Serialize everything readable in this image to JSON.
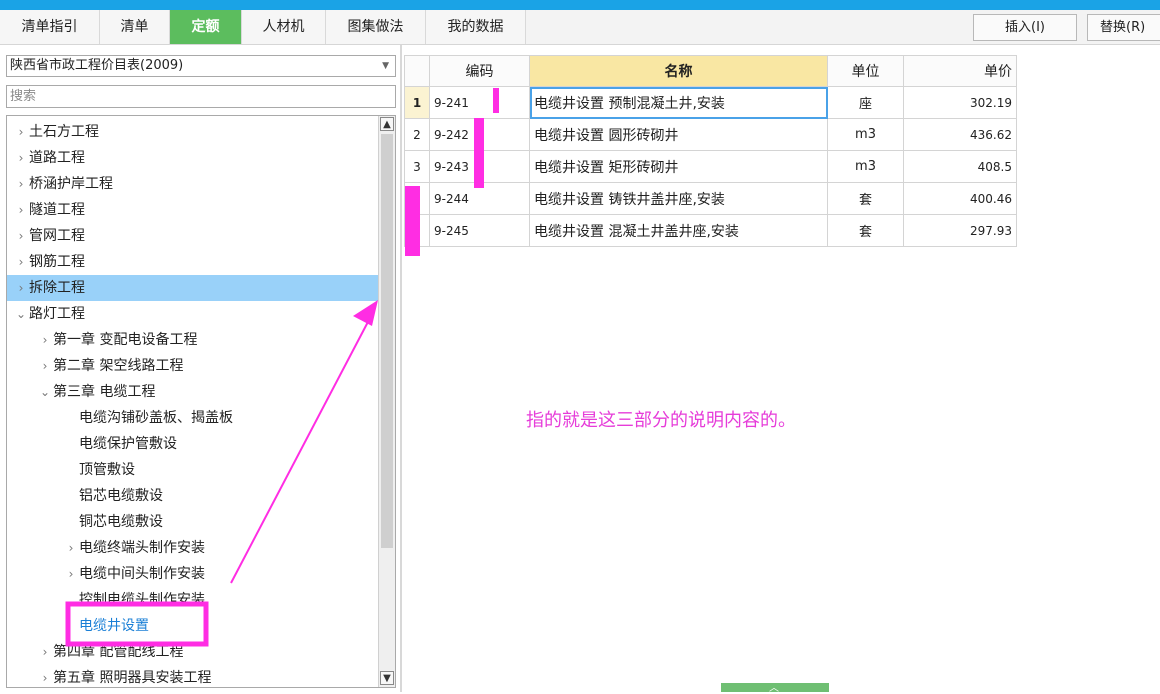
{
  "tabs": [
    {
      "label": "清单指引",
      "active": false
    },
    {
      "label": "清单",
      "active": false
    },
    {
      "label": "定额",
      "active": true
    },
    {
      "label": "人材机",
      "active": false
    },
    {
      "label": "图集做法",
      "active": false
    },
    {
      "label": "我的数据",
      "active": false
    }
  ],
  "toolbar": {
    "insert_label": "插入(I)",
    "replace_label": "替换(R)"
  },
  "left": {
    "library": "陕西省市政工程价目表(2009)",
    "search_placeholder": "搜索",
    "tree": [
      {
        "label": "土石方工程",
        "chevron": "›",
        "level": 0,
        "state": "collapsed"
      },
      {
        "label": "道路工程",
        "chevron": "›",
        "level": 0,
        "state": "collapsed"
      },
      {
        "label": "桥涵护岸工程",
        "chevron": "›",
        "level": 0,
        "state": "collapsed"
      },
      {
        "label": "隧道工程",
        "chevron": "›",
        "level": 0,
        "state": "collapsed"
      },
      {
        "label": "管网工程",
        "chevron": "›",
        "level": 0,
        "state": "collapsed"
      },
      {
        "label": "钢筋工程",
        "chevron": "›",
        "level": 0,
        "state": "collapsed"
      },
      {
        "label": "拆除工程",
        "chevron": "›",
        "level": 0,
        "state": "highlight"
      },
      {
        "label": "路灯工程",
        "chevron": "⌄",
        "level": 0,
        "state": "expanded"
      },
      {
        "label": "第一章 变配电设备工程",
        "chevron": "›",
        "level": 1,
        "state": "collapsed"
      },
      {
        "label": "第二章 架空线路工程",
        "chevron": "›",
        "level": 1,
        "state": "collapsed"
      },
      {
        "label": "第三章 电缆工程",
        "chevron": "⌄",
        "level": 1,
        "state": "expanded"
      },
      {
        "label": "电缆沟铺砂盖板、揭盖板",
        "chevron": "",
        "level": 2,
        "state": "leaf"
      },
      {
        "label": "电缆保护管敷设",
        "chevron": "",
        "level": 2,
        "state": "leaf"
      },
      {
        "label": "顶管敷设",
        "chevron": "",
        "level": 2,
        "state": "leaf"
      },
      {
        "label": "铝芯电缆敷设",
        "chevron": "",
        "level": 2,
        "state": "leaf"
      },
      {
        "label": "铜芯电缆敷设",
        "chevron": "",
        "level": 2,
        "state": "leaf"
      },
      {
        "label": "电缆终端头制作安装",
        "chevron": "›",
        "level": 2,
        "state": "collapsed"
      },
      {
        "label": "电缆中间头制作安装",
        "chevron": "›",
        "level": 2,
        "state": "collapsed"
      },
      {
        "label": "控制电缆头制作安装",
        "chevron": "",
        "level": 2,
        "state": "leaf"
      },
      {
        "label": "电缆井设置",
        "chevron": "",
        "level": 2,
        "state": "selected"
      },
      {
        "label": "第四章 配管配线工程",
        "chevron": "›",
        "level": 1,
        "state": "collapsed"
      },
      {
        "label": "第五章 照明器具安装工程",
        "chevron": "›",
        "level": 1,
        "state": "collapsed"
      }
    ]
  },
  "table": {
    "headers": {
      "code": "编码",
      "name": "名称",
      "unit": "单位",
      "price": "单价"
    },
    "rows": [
      {
        "idx": "1",
        "code": "9-241",
        "name": "电缆井设置 预制混凝土井,安装",
        "unit": "座",
        "price": "302.19"
      },
      {
        "idx": "2",
        "code": "9-242",
        "name": "电缆井设置 圆形砖砌井",
        "unit": "m3",
        "price": "436.62"
      },
      {
        "idx": "3",
        "code": "9-243",
        "name": "电缆井设置 矩形砖砌井",
        "unit": "m3",
        "price": "408.5"
      },
      {
        "idx": "",
        "code": "9-244",
        "name": "电缆井设置 铸铁井盖井座,安装",
        "unit": "套",
        "price": "400.46"
      },
      {
        "idx": "",
        "code": "9-245",
        "name": "电缆井设置 混凝土井盖井座,安装",
        "unit": "套",
        "price": "297.93"
      }
    ]
  },
  "annotation": "指的就是这三部分的说明内容的。",
  "colors": {
    "accent": "#5cbd5e",
    "highlight": "#99d1f9",
    "marker": "#ff2de3"
  }
}
